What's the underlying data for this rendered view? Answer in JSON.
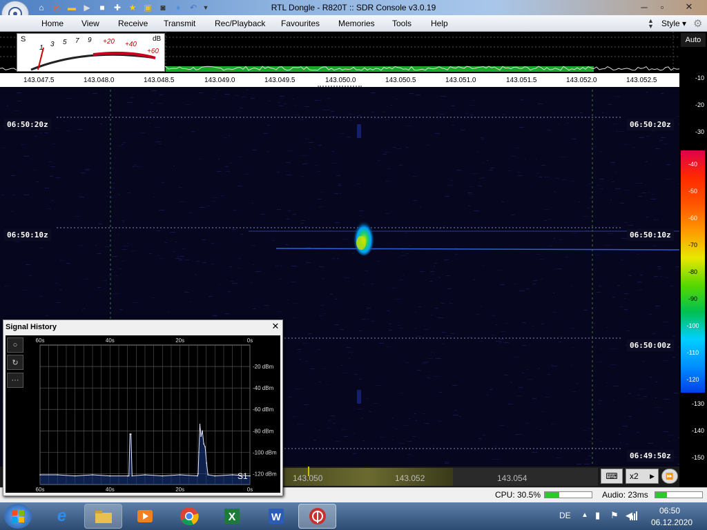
{
  "window": {
    "title": "RTL Dongle - R820T :: SDR Console v3.0.19",
    "buttons": [
      "minimize",
      "maximize",
      "close"
    ]
  },
  "quick_access": [
    "home-icon",
    "lifebuoy-icon",
    "folder-icon",
    "play-icon",
    "stop-icon",
    "plus-icon",
    "star-icon",
    "lock-icon",
    "camera-icon",
    "drop-icon",
    "undo-icon",
    "dropdown-icon"
  ],
  "menu": {
    "items": [
      "Home",
      "View",
      "Receive",
      "Transmit",
      "Rec/Playback",
      "Favourites",
      "Memories",
      "Tools",
      "Help"
    ],
    "style_label": "Style"
  },
  "smeter": {
    "s_label": "S",
    "db_label": "dB",
    "scale": [
      "1",
      "3",
      "5",
      "7",
      "9",
      "+20",
      "+40",
      "+60"
    ]
  },
  "right_scale": {
    "auto_label": "Auto",
    "db_values": [
      "-10",
      "-20",
      "-30",
      "-40",
      "-50",
      "-60",
      "-70",
      "-80",
      "-90",
      "-100",
      "-110",
      "-120",
      "-130",
      "-140",
      "-150"
    ],
    "colors": [
      "#e0004a",
      "#ff2a00",
      "#ff5500",
      "#ff9a00",
      "#e8e800",
      "#58d800",
      "#00c050",
      "#00d0ff",
      "#0090ff",
      "#0040e8",
      "#0010c0"
    ]
  },
  "frequency_axis": [
    "143.047.5",
    "143.048.0",
    "143.048.5",
    "143.049.0",
    "143.049.5",
    "143.050.0",
    "143.050.5",
    "143.051.0",
    "143.051.5",
    "143.052.0",
    "143.052.5"
  ],
  "waterfall": {
    "timestamps": [
      "06:50:20z",
      "06:50:10z",
      "06:50:00z",
      "06:49:50z"
    ]
  },
  "bottom_bar": {
    "freqs": [
      "143.050",
      "143.052",
      "143.054"
    ],
    "zoom_label": "x2"
  },
  "status": {
    "cpu": "CPU: 30.5%",
    "cpu_level": 0.305,
    "audio": "Audio: 23ms",
    "audio_level": 0.25
  },
  "signal_history": {
    "title": "Signal History",
    "time_labels": [
      "60s",
      "40s",
      "20s",
      "0s"
    ],
    "dbm_labels": [
      "-20 dBm",
      "-40 dBm",
      "-60 dBm",
      "-80 dBm",
      "-100 dBm",
      "-120 dBm"
    ],
    "s_reading": "S1",
    "buttons": [
      "circle-icon",
      "refresh-icon",
      "more-icon"
    ],
    "chart_data": {
      "type": "line",
      "xlabel": "",
      "ylabel": "",
      "xlim": [
        60,
        0
      ],
      "ylim": [
        -130,
        0
      ],
      "x": [
        60,
        55,
        50,
        45,
        40,
        35,
        34.6,
        34.3,
        34,
        33.7,
        30,
        25,
        20,
        15,
        14.8,
        14.6,
        14.3,
        14,
        13.6,
        13.2,
        12.8,
        12.4,
        12,
        10,
        5,
        0
      ],
      "y": [
        -121,
        -121,
        -122,
        -121,
        -122,
        -122,
        -122,
        -83,
        -83,
        -122,
        -121,
        -122,
        -121,
        -122,
        -120,
        -100,
        -74,
        -85,
        -80,
        -92,
        -95,
        -110,
        -121,
        -122,
        -121,
        -122
      ]
    }
  },
  "taskbar": {
    "apps": [
      "windows-start-icon",
      "internet-explorer-icon",
      "file-explorer-icon",
      "media-player-icon",
      "chrome-icon",
      "excel-icon",
      "word-icon",
      "sdr-console-icon"
    ],
    "language": "DE",
    "time": "06:50",
    "date": "06.12.2020"
  }
}
